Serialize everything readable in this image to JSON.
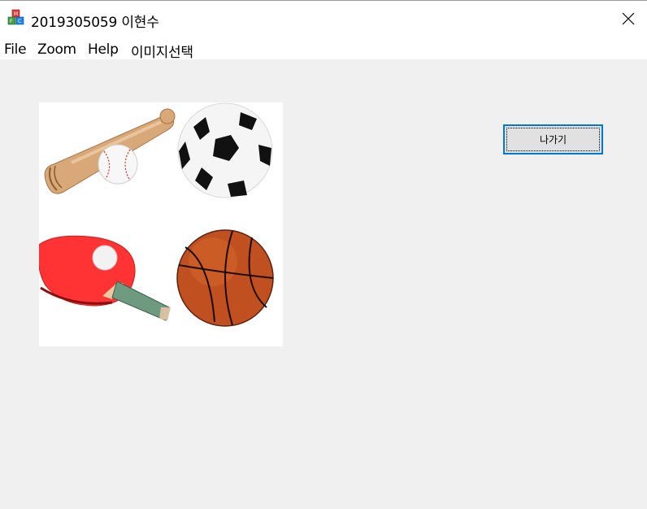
{
  "window": {
    "title": "2019305059 이현수",
    "close_glyph": "✕"
  },
  "menu": {
    "items": [
      "File",
      "Zoom",
      "Help",
      "이미지선택"
    ]
  },
  "main": {
    "exit_button_label": "나가기",
    "image_panel": {
      "icons": [
        "baseball-bat-and-ball-icon",
        "soccer-ball-icon",
        "ping-pong-paddle-icon",
        "basketball-icon"
      ]
    }
  },
  "colors": {
    "client_bg": "#f0f0f0",
    "button_focus": "#0078d7",
    "paddle_red": "#ff3333",
    "basketball": "#c0501f"
  }
}
